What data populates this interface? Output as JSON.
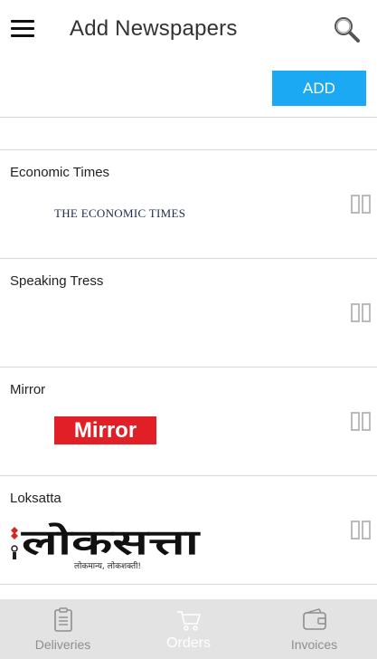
{
  "header": {
    "title": "Add Newspapers",
    "menu_icon": "hamburger-menu-icon",
    "search_icon": "search-icon"
  },
  "toolbar": {
    "add_label": "ADD",
    "add_color": "#1aa9f2"
  },
  "newspapers": [
    {
      "name": "Economic Times",
      "logo_text": "THE ECONOMIC TIMES",
      "logo": "economic-times-logo"
    },
    {
      "name": "Speaking Tress",
      "logo_text": "",
      "logo": ""
    },
    {
      "name": "Mirror",
      "logo_text": "Mirror",
      "logo": "mirror-logo",
      "logo_color": "#e01f26"
    },
    {
      "name": "Loksatta",
      "logo_text": "लोकसत्ता",
      "logo_subtext": "लोकमान्य, लोकशक्ती!",
      "logo": "loksatta-logo"
    }
  ],
  "bottom_nav": {
    "tabs": [
      {
        "label": "Deliveries",
        "icon": "clipboard-icon",
        "active": false
      },
      {
        "label": "Orders",
        "icon": "cart-icon",
        "active": true
      },
      {
        "label": "Invoices",
        "icon": "wallet-icon",
        "active": false
      }
    ]
  }
}
